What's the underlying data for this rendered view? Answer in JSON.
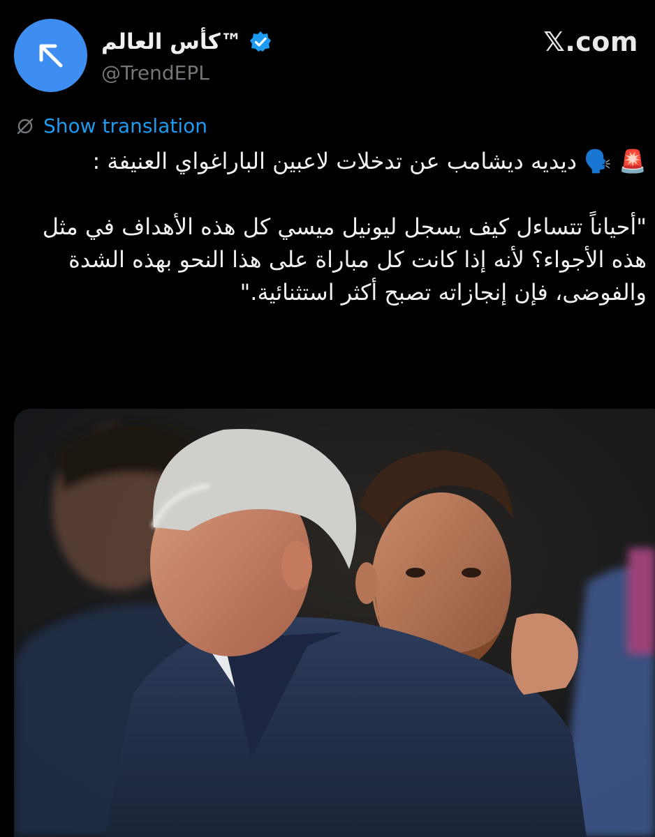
{
  "header": {
    "display_name": "كأس العالم™",
    "handle": "@TrendEPL",
    "site": "𝕏.com",
    "avatar_icon": "arrow-up-left-icon",
    "verified_icon": "verified-badge-icon",
    "avatar_color": "#3d8ef0",
    "verified_color": "#1d9bf0"
  },
  "translate": {
    "label": "Show translation",
    "icon": "globe-slash-icon"
  },
  "tweet": {
    "line1": "🚨 🗣️ ديديه ديشامب عن تدخلات لاعبين الباراغواي العنيفة :",
    "quote": "\"أحياناً تتساءل كيف يسجل ليونيل ميسي كل هذه الأهداف في مثل هذه الأجواء؟ لأنه إذا كانت كل مباراة على هذا النحو بهذه الشدة والفوضى، فإن إنجازاته تصبح أكثر استثنائية.\""
  },
  "media": {
    "kind": "photo"
  }
}
